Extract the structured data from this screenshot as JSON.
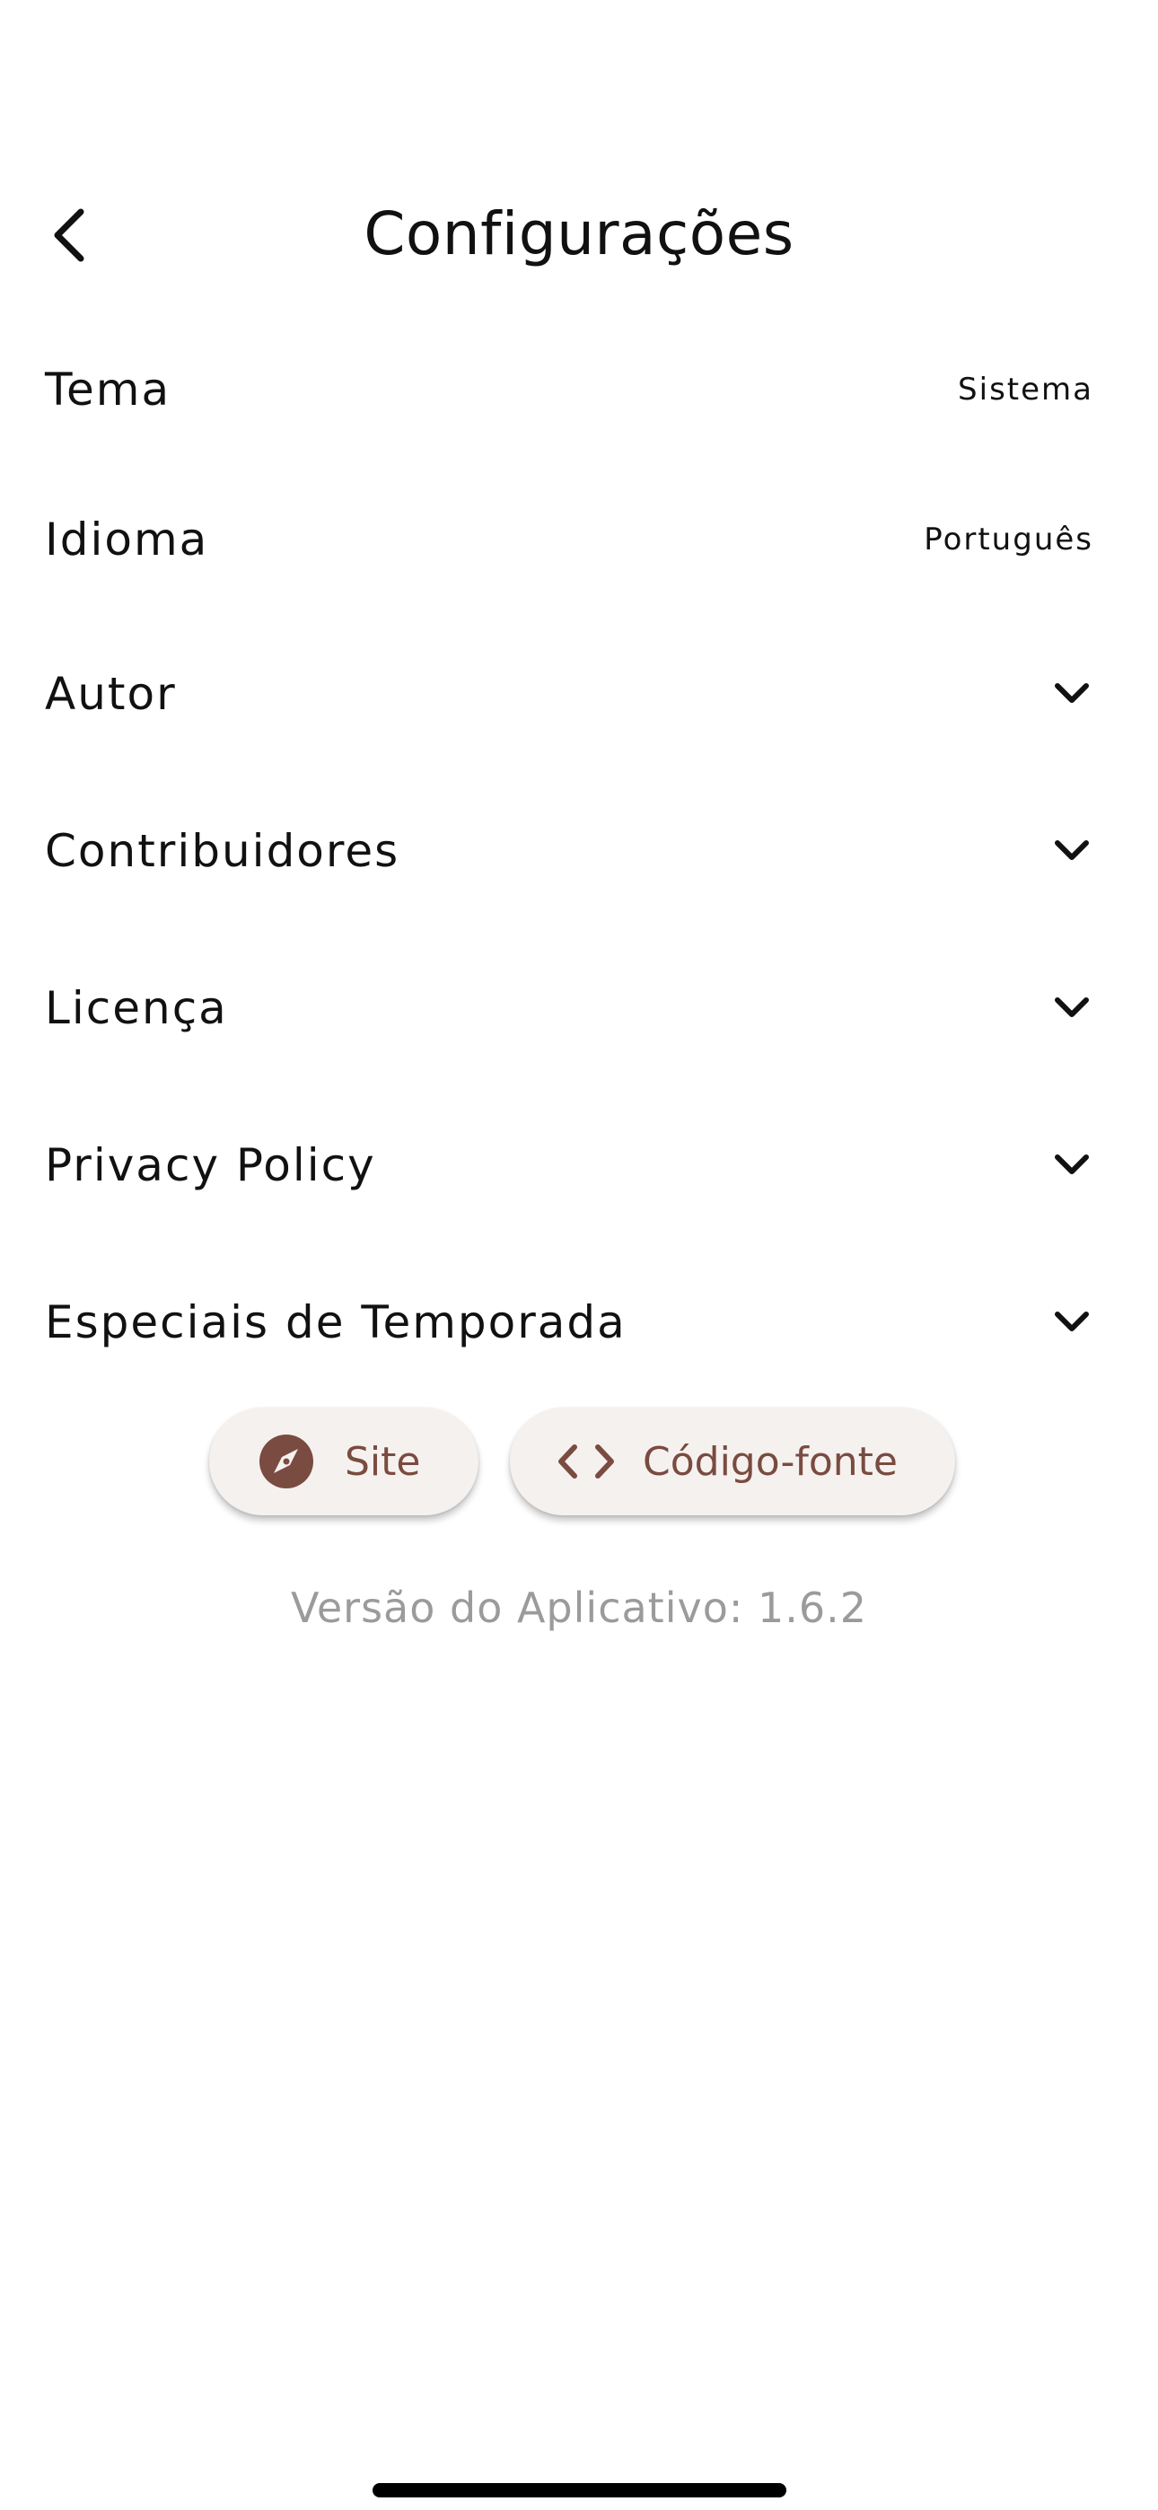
{
  "header": {
    "title": "Configurações",
    "back_icon": "chevron-left-icon"
  },
  "settings": {
    "items": [
      {
        "label": "Tema",
        "value": "Sistema",
        "kind": "value"
      },
      {
        "label": "Idioma",
        "value": "Português",
        "kind": "value"
      },
      {
        "label": "Autor",
        "kind": "expandable",
        "icon": "chevron-down-icon"
      },
      {
        "label": "Contribuidores",
        "kind": "expandable",
        "icon": "chevron-down-icon"
      },
      {
        "label": "Licença",
        "kind": "expandable",
        "icon": "chevron-down-icon"
      },
      {
        "label": "Privacy Policy",
        "kind": "expandable",
        "icon": "chevron-down-icon"
      },
      {
        "label": "Especiais de Temporada",
        "kind": "expandable",
        "icon": "chevron-down-icon"
      }
    ]
  },
  "links": {
    "site": {
      "label": "Site",
      "icon": "compass-icon"
    },
    "source": {
      "label": "Código-fonte",
      "icon": "code-icon"
    }
  },
  "footer": {
    "version": "Versão do Aplicativo: 1.6.2"
  },
  "colors": {
    "accent": "#7a4b40",
    "pill_background": "#f5f1ef",
    "muted_text": "#9b9b9b",
    "text": "#111111"
  }
}
